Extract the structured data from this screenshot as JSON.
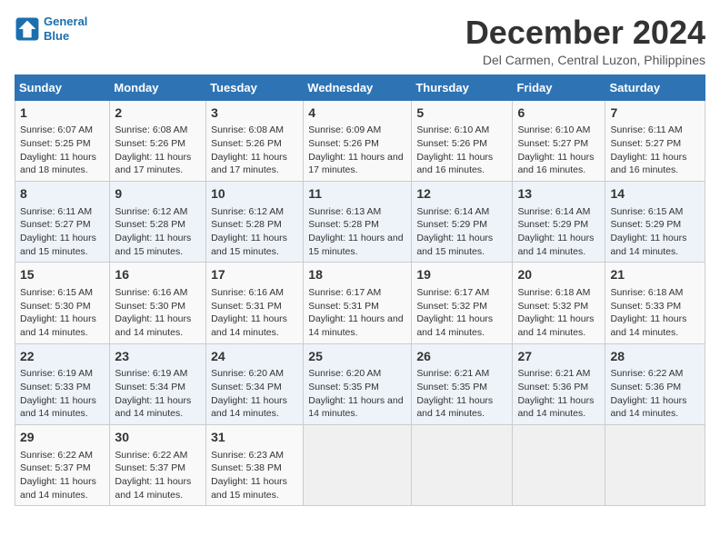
{
  "header": {
    "logo_line1": "General",
    "logo_line2": "Blue",
    "title": "December 2024",
    "subtitle": "Del Carmen, Central Luzon, Philippines"
  },
  "days_of_week": [
    "Sunday",
    "Monday",
    "Tuesday",
    "Wednesday",
    "Thursday",
    "Friday",
    "Saturday"
  ],
  "weeks": [
    [
      {
        "day": "1",
        "info": "Sunrise: 6:07 AM\nSunset: 5:25 PM\nDaylight: 11 hours and 18 minutes."
      },
      {
        "day": "2",
        "info": "Sunrise: 6:08 AM\nSunset: 5:26 PM\nDaylight: 11 hours and 17 minutes."
      },
      {
        "day": "3",
        "info": "Sunrise: 6:08 AM\nSunset: 5:26 PM\nDaylight: 11 hours and 17 minutes."
      },
      {
        "day": "4",
        "info": "Sunrise: 6:09 AM\nSunset: 5:26 PM\nDaylight: 11 hours and 17 minutes."
      },
      {
        "day": "5",
        "info": "Sunrise: 6:10 AM\nSunset: 5:26 PM\nDaylight: 11 hours and 16 minutes."
      },
      {
        "day": "6",
        "info": "Sunrise: 6:10 AM\nSunset: 5:27 PM\nDaylight: 11 hours and 16 minutes."
      },
      {
        "day": "7",
        "info": "Sunrise: 6:11 AM\nSunset: 5:27 PM\nDaylight: 11 hours and 16 minutes."
      }
    ],
    [
      {
        "day": "8",
        "info": "Sunrise: 6:11 AM\nSunset: 5:27 PM\nDaylight: 11 hours and 15 minutes."
      },
      {
        "day": "9",
        "info": "Sunrise: 6:12 AM\nSunset: 5:28 PM\nDaylight: 11 hours and 15 minutes."
      },
      {
        "day": "10",
        "info": "Sunrise: 6:12 AM\nSunset: 5:28 PM\nDaylight: 11 hours and 15 minutes."
      },
      {
        "day": "11",
        "info": "Sunrise: 6:13 AM\nSunset: 5:28 PM\nDaylight: 11 hours and 15 minutes."
      },
      {
        "day": "12",
        "info": "Sunrise: 6:14 AM\nSunset: 5:29 PM\nDaylight: 11 hours and 15 minutes."
      },
      {
        "day": "13",
        "info": "Sunrise: 6:14 AM\nSunset: 5:29 PM\nDaylight: 11 hours and 14 minutes."
      },
      {
        "day": "14",
        "info": "Sunrise: 6:15 AM\nSunset: 5:29 PM\nDaylight: 11 hours and 14 minutes."
      }
    ],
    [
      {
        "day": "15",
        "info": "Sunrise: 6:15 AM\nSunset: 5:30 PM\nDaylight: 11 hours and 14 minutes."
      },
      {
        "day": "16",
        "info": "Sunrise: 6:16 AM\nSunset: 5:30 PM\nDaylight: 11 hours and 14 minutes."
      },
      {
        "day": "17",
        "info": "Sunrise: 6:16 AM\nSunset: 5:31 PM\nDaylight: 11 hours and 14 minutes."
      },
      {
        "day": "18",
        "info": "Sunrise: 6:17 AM\nSunset: 5:31 PM\nDaylight: 11 hours and 14 minutes."
      },
      {
        "day": "19",
        "info": "Sunrise: 6:17 AM\nSunset: 5:32 PM\nDaylight: 11 hours and 14 minutes."
      },
      {
        "day": "20",
        "info": "Sunrise: 6:18 AM\nSunset: 5:32 PM\nDaylight: 11 hours and 14 minutes."
      },
      {
        "day": "21",
        "info": "Sunrise: 6:18 AM\nSunset: 5:33 PM\nDaylight: 11 hours and 14 minutes."
      }
    ],
    [
      {
        "day": "22",
        "info": "Sunrise: 6:19 AM\nSunset: 5:33 PM\nDaylight: 11 hours and 14 minutes."
      },
      {
        "day": "23",
        "info": "Sunrise: 6:19 AM\nSunset: 5:34 PM\nDaylight: 11 hours and 14 minutes."
      },
      {
        "day": "24",
        "info": "Sunrise: 6:20 AM\nSunset: 5:34 PM\nDaylight: 11 hours and 14 minutes."
      },
      {
        "day": "25",
        "info": "Sunrise: 6:20 AM\nSunset: 5:35 PM\nDaylight: 11 hours and 14 minutes."
      },
      {
        "day": "26",
        "info": "Sunrise: 6:21 AM\nSunset: 5:35 PM\nDaylight: 11 hours and 14 minutes."
      },
      {
        "day": "27",
        "info": "Sunrise: 6:21 AM\nSunset: 5:36 PM\nDaylight: 11 hours and 14 minutes."
      },
      {
        "day": "28",
        "info": "Sunrise: 6:22 AM\nSunset: 5:36 PM\nDaylight: 11 hours and 14 minutes."
      }
    ],
    [
      {
        "day": "29",
        "info": "Sunrise: 6:22 AM\nSunset: 5:37 PM\nDaylight: 11 hours and 14 minutes."
      },
      {
        "day": "30",
        "info": "Sunrise: 6:22 AM\nSunset: 5:37 PM\nDaylight: 11 hours and 14 minutes."
      },
      {
        "day": "31",
        "info": "Sunrise: 6:23 AM\nSunset: 5:38 PM\nDaylight: 11 hours and 15 minutes."
      },
      null,
      null,
      null,
      null
    ]
  ]
}
